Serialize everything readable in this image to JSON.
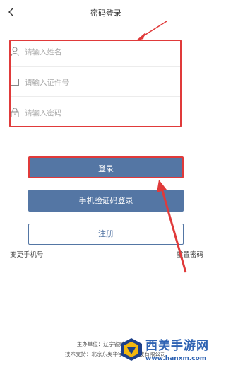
{
  "nav": {
    "title": "密码登录"
  },
  "form": {
    "name_placeholder": "请输入姓名",
    "id_placeholder": "请输入证件号",
    "password_placeholder": "请输入密码"
  },
  "buttons": {
    "login": "登录",
    "sms_login": "手机验证码登录",
    "register": "注册"
  },
  "links": {
    "change_phone": "变更手机号",
    "reset_password": "重置密码"
  },
  "footer": {
    "sponsor": "主办单位：辽宁省财政厅",
    "tech_support": "技术支持：北京东奥华宇国际科技有限公司"
  },
  "watermark": {
    "brand": "西美手游网",
    "url": "www.hanxm.com"
  },
  "colors": {
    "primary": "#5476a4",
    "annotation": "#e03a3a"
  }
}
